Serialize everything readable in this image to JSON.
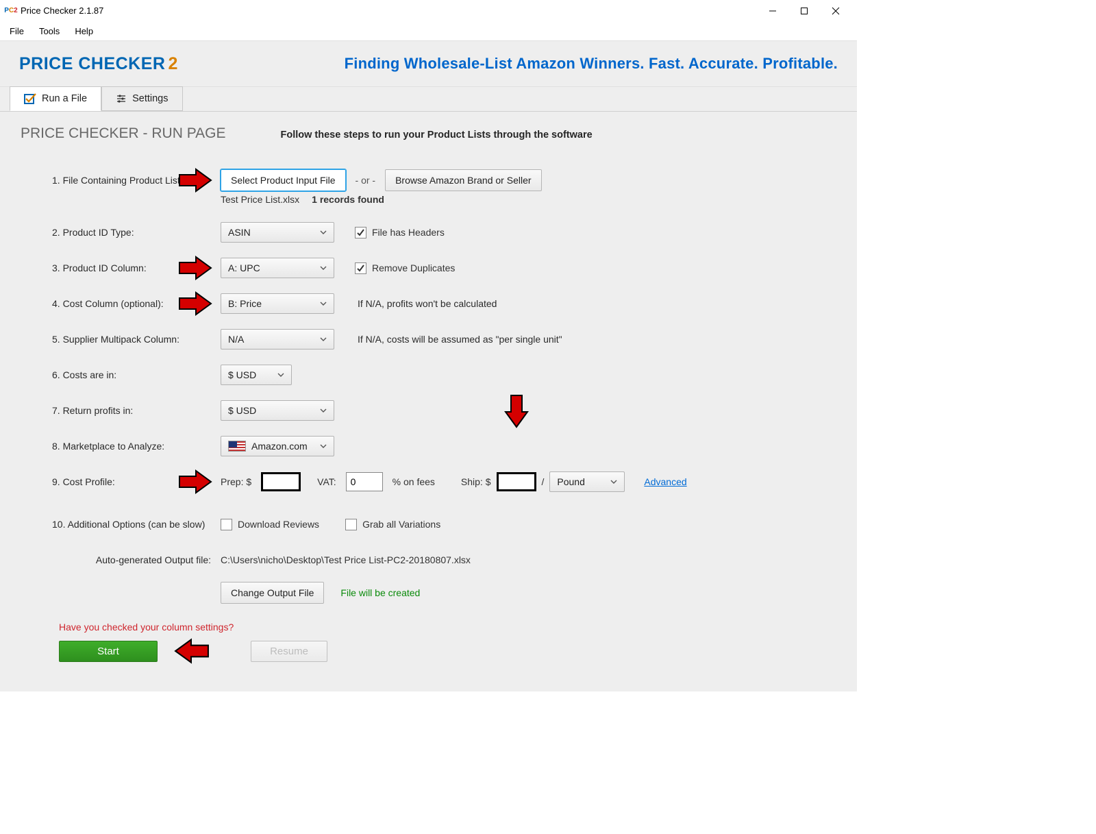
{
  "window": {
    "title": "Price Checker 2.1.87"
  },
  "menubar": {
    "file": "File",
    "tools": "Tools",
    "help": "Help"
  },
  "header": {
    "brand": "PRICE CHECKER",
    "brand_suffix": "2",
    "tagline": "Finding Wholesale-List Amazon Winners. Fast. Accurate. Profitable."
  },
  "tabs": {
    "run": "Run a File",
    "settings": "Settings"
  },
  "page": {
    "title": "PRICE CHECKER - RUN PAGE",
    "instructions": "Follow these steps to run your Product Lists through the software"
  },
  "steps": {
    "s1_label": "1. File Containing Product List:",
    "s1_btn_select": "Select Product Input File",
    "s1_or": "- or -",
    "s1_btn_browse": "Browse Amazon Brand or Seller",
    "s1_filename": "Test Price List.xlsx",
    "s1_records": "1 records found",
    "s2_label": "2. Product ID Type:",
    "s2_value": "ASIN",
    "s2_cbx": "File has Headers",
    "s3_label": "3. Product ID Column:",
    "s3_value": "A: UPC",
    "s3_cbx": "Remove Duplicates",
    "s4_label": "4. Cost Column (optional):",
    "s4_value": "B: Price",
    "s4_hint": "If N/A, profits won't be calculated",
    "s5_label": "5. Supplier Multipack Column:",
    "s5_value": "N/A",
    "s5_hint": "If N/A, costs will be assumed as \"per single unit\"",
    "s6_label": "6. Costs are in:",
    "s6_value": "$ USD",
    "s7_label": "7. Return profits in:",
    "s7_value": "$ USD",
    "s8_label": "8. Marketplace to Analyze:",
    "s8_value": "Amazon.com",
    "s9_label": "9. Cost Profile:",
    "s9_prep": "Prep: $",
    "s9_vat": "VAT:",
    "s9_vat_value": "0",
    "s9_vat_suffix": "% on fees",
    "s9_ship": "Ship: $",
    "s9_per": "/",
    "s9_unit": "Pound",
    "s9_adv": "Advanced",
    "s10_label": "10. Additional Options (can be slow)",
    "s10_cbx1": "Download Reviews",
    "s10_cbx2": "Grab all Variations",
    "output_label": "Auto-generated Output file:",
    "output_path": "C:\\Users\\nicho\\Desktop\\Test Price List-PC2-20180807.xlsx",
    "change_output": "Change Output File",
    "output_status": "File will be created"
  },
  "footer": {
    "warning": "Have you checked your column settings?",
    "start": "Start",
    "resume": "Resume"
  }
}
